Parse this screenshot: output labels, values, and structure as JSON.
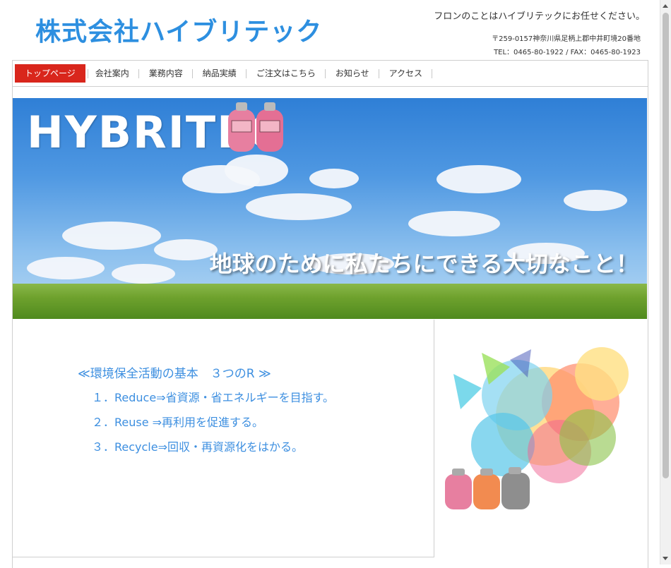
{
  "header": {
    "company_name": "株式会社ハイブリテック",
    "tagline": "フロンのことはハイブリテックにお任せください。",
    "address": "〒259-0157神奈川県足柄上郡中井町境20番地",
    "tel": "TEL：0465-80-1922 / FAX：0465-80-1923"
  },
  "nav": {
    "items": [
      {
        "label": "トップページ"
      },
      {
        "label": "会社案内"
      },
      {
        "label": "業務内容"
      },
      {
        "label": "納品実績"
      },
      {
        "label": "ご注文はこちら"
      },
      {
        "label": "お知らせ"
      },
      {
        "label": "アクセス"
      }
    ],
    "active_index": 0
  },
  "hero": {
    "brand": "HYBRITEC",
    "slogan": "地球のために私たちにできる大切なこと！"
  },
  "principles": {
    "title": "≪環境保全活動の基本　３つのR ≫",
    "items": [
      "１．Reduce⇒省資源・省エネルギーを目指す。",
      "２．Reuse ⇒再利用を促進する。",
      "３．Recycle⇒回収・再資源化をはかる。"
    ]
  },
  "colors": {
    "accent_red": "#d9261c",
    "brand_blue": "#2d8fe0",
    "text_blue": "#3d8fe0"
  }
}
